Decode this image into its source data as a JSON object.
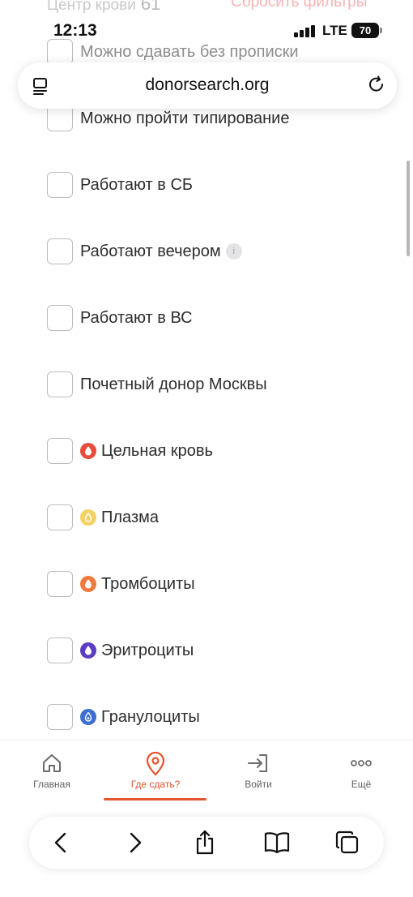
{
  "peek_header": {
    "left_text": "Центр крови",
    "left_count": "61",
    "right_text": "Сбросить фильтры"
  },
  "status_bar": {
    "time": "12:13",
    "network": "LTE",
    "battery": "70"
  },
  "address_bar": {
    "url": "donorsearch.org"
  },
  "filters": [
    {
      "label": "Можно сдавать без прописки",
      "checked": false
    },
    {
      "label": "Можно пройти типирование",
      "checked": false
    },
    {
      "label": "Работают в СБ",
      "checked": false
    },
    {
      "label": "Работают вечером",
      "checked": false,
      "has_info": true,
      "info_glyph": "i"
    },
    {
      "label": "Работают в ВС",
      "checked": false
    },
    {
      "label": "Почетный донор Москвы",
      "checked": false
    },
    {
      "label": "Цельная кровь",
      "checked": false,
      "icon": "blood-drop-icon",
      "color": "#e74c3c"
    },
    {
      "label": "Плазма",
      "checked": false,
      "icon": "plasma-drop-icon",
      "color": "#f4d160"
    },
    {
      "label": "Тромбоциты",
      "checked": false,
      "icon": "platelets-drop-icon",
      "color": "#f07a3c"
    },
    {
      "label": "Эритроциты",
      "checked": false,
      "icon": "erythrocytes-drop-icon",
      "color": "#5b3cc4"
    },
    {
      "label": "Гранулоциты",
      "checked": false,
      "icon": "granulocytes-drop-icon",
      "color": "#3d6fd0"
    }
  ],
  "tab_bar": {
    "active_color": "#e3542f",
    "tabs": [
      {
        "label": "Главная",
        "icon": "home-icon",
        "active": false
      },
      {
        "label": "Где сдать?",
        "icon": "location-pin-icon",
        "active": true
      },
      {
        "label": "Войти",
        "icon": "login-icon",
        "active": false
      },
      {
        "label": "Ещё",
        "icon": "more-icon",
        "active": false
      }
    ]
  },
  "browser_toolbar": [
    "back-icon",
    "forward-icon",
    "share-icon",
    "bookmarks-icon",
    "tabs-icon"
  ]
}
